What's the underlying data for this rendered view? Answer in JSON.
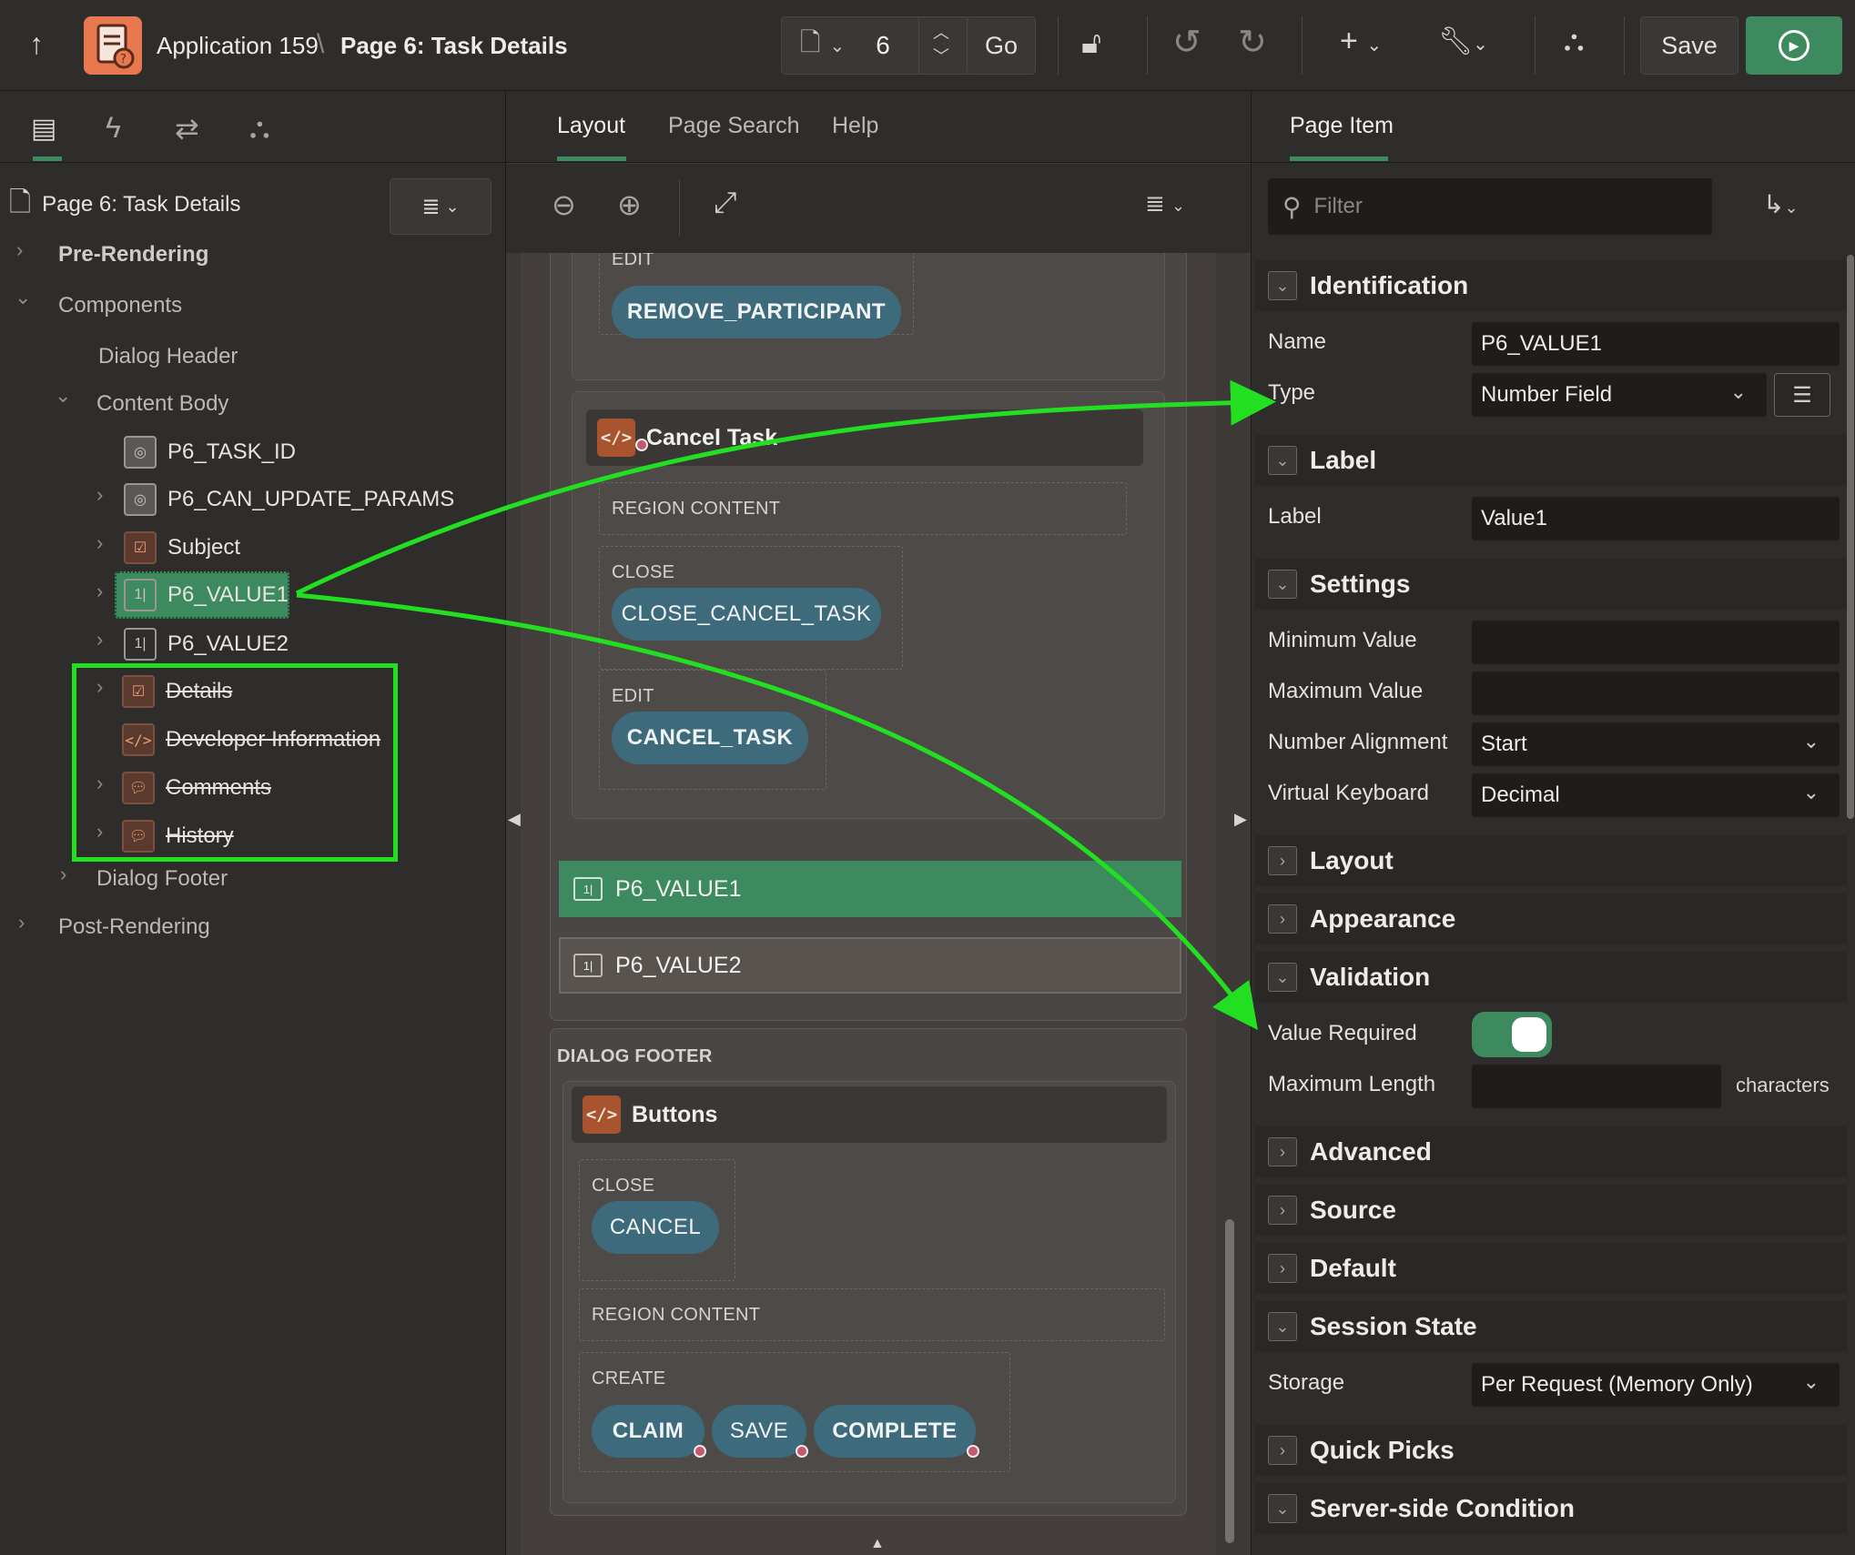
{
  "header": {
    "app_name": "Application 159",
    "breadcrumb_sep": "\\",
    "page_title": "Page 6: Task Details",
    "page_number": "6",
    "go_label": "Go",
    "save_label": "Save"
  },
  "left": {
    "page_node": "Page 6: Task Details",
    "tree": {
      "pre_rendering": "Pre-Rendering",
      "components": "Components",
      "dialog_header": "Dialog Header",
      "content_body": "Content Body",
      "item_task_id": "P6_TASK_ID",
      "item_can_update": "P6_CAN_UPDATE_PARAMS",
      "subject": "Subject",
      "item_value1": "P6_VALUE1",
      "item_value2": "P6_VALUE2",
      "details": "Details",
      "dev_info": "Developer Information",
      "comments": "Comments",
      "history": "History",
      "dialog_footer": "Dialog Footer",
      "post_rendering": "Post-Rendering"
    }
  },
  "center": {
    "tabs": {
      "layout": "Layout",
      "page_search": "Page Search",
      "help": "Help"
    },
    "slots": {
      "edit1": "EDIT",
      "region_content": "REGION CONTENT",
      "close": "CLOSE",
      "edit2": "EDIT",
      "dialog_footer": "DIALOG FOOTER",
      "close_footer": "CLOSE",
      "region_content_footer": "REGION CONTENT",
      "create": "CREATE"
    },
    "buttons": {
      "remove_participant": "REMOVE_PARTICIPANT",
      "close_cancel_task": "CLOSE_CANCEL_TASK",
      "cancel_task": "CANCEL_TASK",
      "cancel": "CANCEL",
      "claim": "CLAIM",
      "save": "SAVE",
      "complete": "COMPLETE"
    },
    "regions": {
      "cancel_task": "Cancel Task",
      "buttons": "Buttons"
    },
    "items": {
      "value1": "P6_VALUE1",
      "value2": "P6_VALUE2"
    }
  },
  "right": {
    "tab": "Page Item",
    "filter_placeholder": "Filter",
    "groups": {
      "identification": "Identification",
      "label": "Label",
      "settings": "Settings",
      "layout": "Layout",
      "appearance": "Appearance",
      "validation": "Validation",
      "advanced": "Advanced",
      "source": "Source",
      "default": "Default",
      "session_state": "Session State",
      "quick_picks": "Quick Picks",
      "server_side_condition": "Server-side Condition"
    },
    "props": {
      "name_label": "Name",
      "name_value": "P6_VALUE1",
      "type_label": "Type",
      "type_value": "Number Field",
      "label_label": "Label",
      "label_value": "Value1",
      "min_label": "Minimum Value",
      "max_label": "Maximum Value",
      "align_label": "Number Alignment",
      "align_value": "Start",
      "vk_label": "Virtual Keyboard",
      "vk_value": "Decimal",
      "required_label": "Value Required",
      "required_value": true,
      "maxlen_label": "Maximum Length",
      "maxlen_suffix": "characters",
      "storage_label": "Storage",
      "storage_value": "Per Request (Memory Only)"
    }
  },
  "colors": {
    "accent_green": "#3d8a5e",
    "annotation_green": "#22e021",
    "button_teal": "#3e6b7c",
    "region_brown": "#a8552f"
  },
  "icons": [
    "up-arrow-icon",
    "page-icon",
    "unlock-icon",
    "undo-icon",
    "redo-icon",
    "plus-icon",
    "wrench-icon",
    "shapes-icon",
    "play-icon",
    "zoom-out-icon",
    "zoom-in-icon",
    "expand-icon",
    "menu-icon",
    "search-icon",
    "hidden-item-icon",
    "checklist-icon",
    "number-field-icon",
    "code-icon",
    "comments-icon"
  ]
}
